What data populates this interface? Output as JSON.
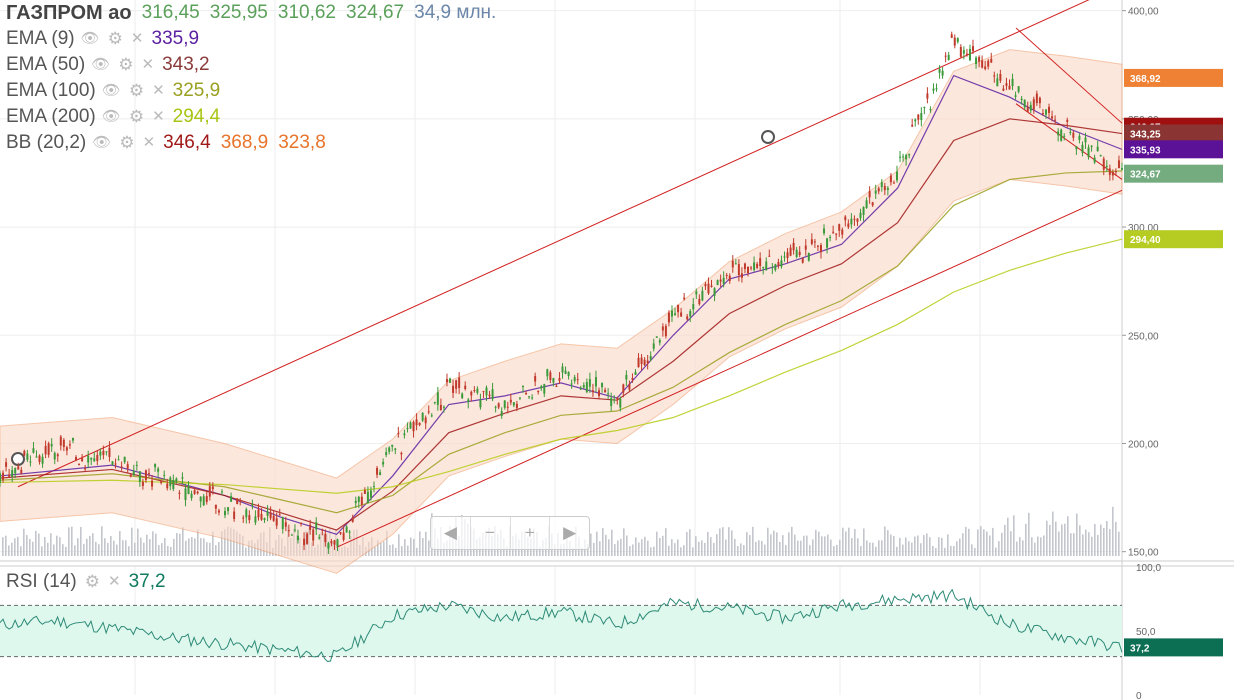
{
  "header": {
    "ticker": "ГАЗПРОМ ао",
    "open": "316,45",
    "high": "325,95",
    "low": "310,62",
    "close": "324,67",
    "volume": "34,9 млн."
  },
  "indicators": [
    {
      "name": "EMA (9)",
      "value": "335,9",
      "color": "#5b1fa1"
    },
    {
      "name": "EMA (50)",
      "value": "343,2",
      "color": "#8b3a3a"
    },
    {
      "name": "EMA (100)",
      "value": "325,9",
      "color": "#9aa020"
    },
    {
      "name": "EMA (200)",
      "value": "294,4",
      "color": "#b5cc18"
    }
  ],
  "bb": {
    "name": "BB (20,2)",
    "mid": "346,4",
    "upper": "368,9",
    "lower": "323,8",
    "mid_color": "#a01818",
    "upper_color": "#e8742c",
    "lower_color": "#e8742c"
  },
  "rsi": {
    "name": "RSI (14)",
    "value": "37,2",
    "color": "#0f7a5f"
  },
  "icons": {
    "eye": "eye-icon",
    "gear": "gear-icon",
    "close": "close-icon"
  },
  "navigator": {
    "left": "◀",
    "minus": "−",
    "plus": "+",
    "right": "▶"
  },
  "price_axis": {
    "ticks": [
      {
        "value": 400,
        "label": "400,00"
      },
      {
        "value": 350,
        "label": "350,00"
      },
      {
        "value": 300,
        "label": "300,00"
      },
      {
        "value": 250,
        "label": "250,00"
      },
      {
        "value": 200,
        "label": "200,00"
      },
      {
        "value": 150,
        "label": "150,00"
      }
    ],
    "badges": [
      {
        "label": "368,92",
        "value": 368.92,
        "color": "#ee8133"
      },
      {
        "label": "346,37",
        "value": 346.37,
        "color": "#a01010"
      },
      {
        "label": "343,25",
        "value": 343.25,
        "color": "#8a3434"
      },
      {
        "label": "335,93",
        "value": 335.93,
        "color": "#5b1296"
      },
      {
        "label": "324,67",
        "value": 324.67,
        "color": "#74ac80"
      },
      {
        "label": "294,40",
        "value": 294.4,
        "color": "#b6cc22"
      }
    ]
  },
  "rsi_axis": {
    "ticks": [
      {
        "value": 100,
        "label": "100,0"
      },
      {
        "value": 50,
        "label": "50,0"
      },
      {
        "value": 0,
        "label": "0"
      }
    ],
    "badge": {
      "label": "37,2",
      "value": 37.2,
      "color": "#0c6e52"
    }
  },
  "chart_data": {
    "type": "candlestick",
    "ylim": [
      148,
      404
    ],
    "series": [
      {
        "name": "close",
        "x": [
          0,
          5,
          10,
          15,
          20,
          25,
          30,
          35,
          40,
          45,
          50,
          55,
          60,
          65,
          70,
          75,
          80,
          85,
          90,
          95,
          100
        ],
        "y": [
          185,
          198,
          192,
          183,
          172,
          162,
          155,
          197,
          225,
          218,
          232,
          220,
          258,
          280,
          285,
          298,
          325,
          385,
          365,
          345,
          324.67
        ]
      },
      {
        "name": "EMA (9)",
        "x": [
          0,
          10,
          20,
          25,
          30,
          35,
          40,
          45,
          50,
          55,
          60,
          65,
          70,
          75,
          80,
          85,
          90,
          95,
          100
        ],
        "y": [
          185,
          190,
          176,
          166,
          158,
          185,
          218,
          222,
          228,
          221,
          250,
          276,
          283,
          292,
          318,
          370,
          360,
          346,
          335.9
        ]
      },
      {
        "name": "EMA (50)",
        "x": [
          0,
          10,
          20,
          25,
          30,
          35,
          40,
          45,
          50,
          55,
          60,
          65,
          70,
          75,
          80,
          85,
          90,
          95,
          100
        ],
        "y": [
          184,
          188,
          176,
          168,
          160,
          178,
          205,
          214,
          222,
          220,
          238,
          260,
          273,
          283,
          302,
          340,
          350,
          347,
          343.2
        ]
      },
      {
        "name": "EMA (100)",
        "x": [
          0,
          10,
          20,
          25,
          30,
          35,
          40,
          45,
          50,
          55,
          60,
          65,
          70,
          75,
          80,
          85,
          90,
          95,
          100
        ],
        "y": [
          183,
          186,
          180,
          174,
          168,
          176,
          195,
          205,
          213,
          215,
          226,
          242,
          255,
          266,
          282,
          310,
          322,
          325,
          325.9
        ]
      },
      {
        "name": "EMA (200)",
        "x": [
          0,
          10,
          20,
          25,
          30,
          35,
          40,
          45,
          50,
          55,
          60,
          65,
          70,
          75,
          80,
          85,
          90,
          95,
          100
        ],
        "y": [
          182,
          183,
          181,
          179,
          177,
          180,
          187,
          195,
          202,
          206,
          212,
          222,
          233,
          243,
          255,
          270,
          280,
          288,
          294.4
        ]
      }
    ],
    "rsi": {
      "x": [
        0,
        5,
        10,
        15,
        20,
        25,
        30,
        35,
        40,
        45,
        50,
        55,
        60,
        65,
        70,
        75,
        80,
        85,
        90,
        95,
        100
      ],
      "y": [
        55,
        58,
        52,
        45,
        40,
        35,
        30,
        62,
        70,
        60,
        65,
        55,
        72,
        68,
        60,
        70,
        75,
        78,
        55,
        45,
        37.2
      ],
      "ylim": [
        0,
        100
      ],
      "bands": [
        30,
        70
      ]
    }
  }
}
